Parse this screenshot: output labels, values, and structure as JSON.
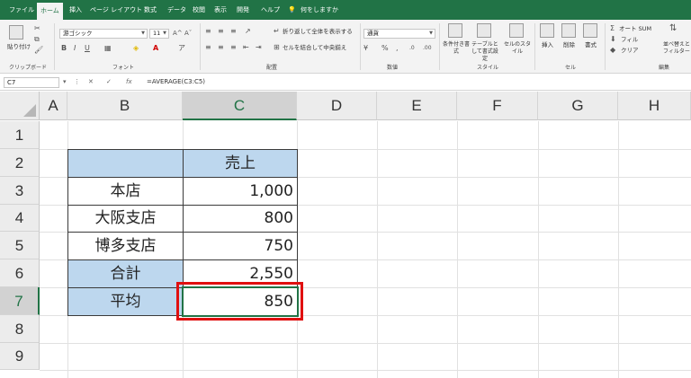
{
  "ribbon": {
    "tabs": [
      {
        "label": "ファイル",
        "name": "tab-file",
        "active": false
      },
      {
        "label": "ホーム",
        "name": "tab-home",
        "active": true
      },
      {
        "label": "挿入",
        "name": "tab-insert",
        "active": false
      },
      {
        "label": "ページ レイアウト",
        "name": "tab-page-layout",
        "active": false
      },
      {
        "label": "数式",
        "name": "tab-formulas",
        "active": false
      },
      {
        "label": "データ",
        "name": "tab-data",
        "active": false
      },
      {
        "label": "校閲",
        "name": "tab-review",
        "active": false
      },
      {
        "label": "表示",
        "name": "tab-view",
        "active": false
      },
      {
        "label": "開発",
        "name": "tab-developer",
        "active": false
      },
      {
        "label": "ヘルプ",
        "name": "tab-help",
        "active": false
      }
    ],
    "tell_me": "何をしますか",
    "clipboard": {
      "paste_label": "貼り付け",
      "group_label": "クリップボード"
    },
    "font": {
      "font_name": "游ゴシック",
      "font_size": "11",
      "group_label": "フォント"
    },
    "alignment": {
      "wrap_text": "折り返して全体を表示する",
      "merge_center": "セルを結合して中央揃え",
      "group_label": "配置"
    },
    "number": {
      "format": "通貨",
      "group_label": "数値"
    },
    "styles": {
      "conditional": "条件付き書式",
      "format_table": "テーブルとして書式設定",
      "cell_styles": "セルのスタイル",
      "group_label": "スタイル"
    },
    "cells": {
      "insert": "挿入",
      "delete": "削除",
      "format": "書式",
      "group_label": "セル"
    },
    "editing": {
      "autosum": "オート SUM",
      "fill": "フィル",
      "clear": "クリア",
      "sort_filter": "並べ替えとフィルター",
      "group_label": "編集"
    }
  },
  "formula_bar": {
    "name_box": "C7",
    "formula": "=AVERAGE(C3:C5)"
  },
  "sheet": {
    "columns": [
      "A",
      "B",
      "C",
      "D",
      "E",
      "F",
      "G",
      "H"
    ],
    "selected_column": "C",
    "rows": [
      "1",
      "2",
      "3",
      "4",
      "5",
      "6",
      "7",
      "8",
      "9"
    ],
    "selected_row": "7",
    "header_cell": "売上",
    "data_rows": [
      {
        "label": "本店",
        "value": "1,000"
      },
      {
        "label": "大阪支店",
        "value": "800"
      },
      {
        "label": "博多支店",
        "value": "750"
      },
      {
        "label": "合計",
        "value": "2,550"
      },
      {
        "label": "平均",
        "value": "850"
      }
    ],
    "colors": {
      "header_fill": "#bdd7ee",
      "highlight": "#e01010",
      "accent": "#217346"
    }
  }
}
